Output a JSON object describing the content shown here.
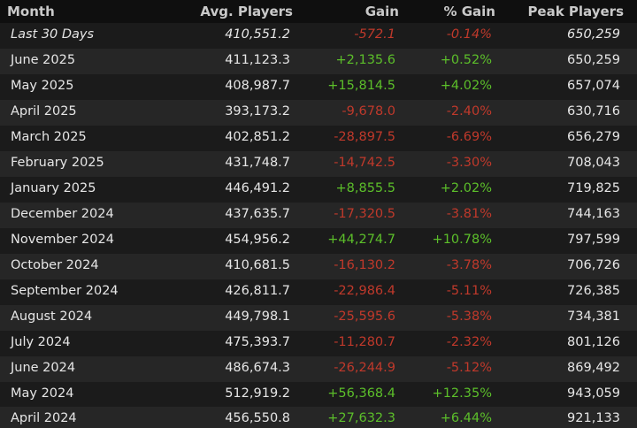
{
  "header": {
    "month": "Month",
    "avg": "Avg. Players",
    "gain": "Gain",
    "pct": "% Gain",
    "peak": "Peak Players"
  },
  "colors": {
    "positive": "#5cbf2a",
    "negative": "#c0392b",
    "header_bg": "#0f0f0f",
    "row_bg": "#1b1b1b",
    "row_alt_bg": "#262626"
  },
  "rows": [
    {
      "month": "Last 30 Days",
      "avg": "410,551.2",
      "gain": "-572.1",
      "pct": "-0.14%",
      "peak": "650,259"
    },
    {
      "month": "June 2025",
      "avg": "411,123.3",
      "gain": "+2,135.6",
      "pct": "+0.52%",
      "peak": "650,259"
    },
    {
      "month": "May 2025",
      "avg": "408,987.7",
      "gain": "+15,814.5",
      "pct": "+4.02%",
      "peak": "657,074"
    },
    {
      "month": "April 2025",
      "avg": "393,173.2",
      "gain": "-9,678.0",
      "pct": "-2.40%",
      "peak": "630,716"
    },
    {
      "month": "March 2025",
      "avg": "402,851.2",
      "gain": "-28,897.5",
      "pct": "-6.69%",
      "peak": "656,279"
    },
    {
      "month": "February 2025",
      "avg": "431,748.7",
      "gain": "-14,742.5",
      "pct": "-3.30%",
      "peak": "708,043"
    },
    {
      "month": "January 2025",
      "avg": "446,491.2",
      "gain": "+8,855.5",
      "pct": "+2.02%",
      "peak": "719,825"
    },
    {
      "month": "December 2024",
      "avg": "437,635.7",
      "gain": "-17,320.5",
      "pct": "-3.81%",
      "peak": "744,163"
    },
    {
      "month": "November 2024",
      "avg": "454,956.2",
      "gain": "+44,274.7",
      "pct": "+10.78%",
      "peak": "797,599"
    },
    {
      "month": "October 2024",
      "avg": "410,681.5",
      "gain": "-16,130.2",
      "pct": "-3.78%",
      "peak": "706,726"
    },
    {
      "month": "September 2024",
      "avg": "426,811.7",
      "gain": "-22,986.4",
      "pct": "-5.11%",
      "peak": "726,385"
    },
    {
      "month": "August 2024",
      "avg": "449,798.1",
      "gain": "-25,595.6",
      "pct": "-5.38%",
      "peak": "734,381"
    },
    {
      "month": "July 2024",
      "avg": "475,393.7",
      "gain": "-11,280.7",
      "pct": "-2.32%",
      "peak": "801,126"
    },
    {
      "month": "June 2024",
      "avg": "486,674.3",
      "gain": "-26,244.9",
      "pct": "-5.12%",
      "peak": "869,492"
    },
    {
      "month": "May 2024",
      "avg": "512,919.2",
      "gain": "+56,368.4",
      "pct": "+12.35%",
      "peak": "943,059"
    },
    {
      "month": "April 2024",
      "avg": "456,550.8",
      "gain": "+27,632.3",
      "pct": "+6.44%",
      "peak": "921,133"
    }
  ]
}
